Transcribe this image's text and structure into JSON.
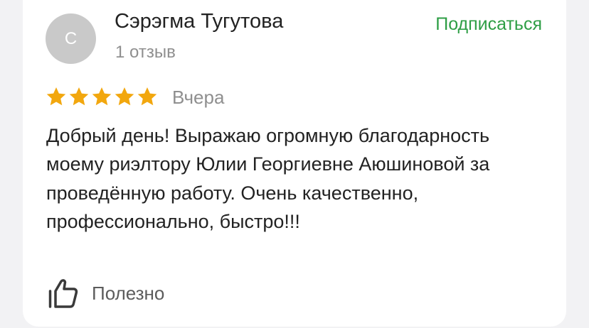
{
  "review": {
    "author": {
      "initial": "С",
      "name": "Сэрэгма Тугутова",
      "reviews_count": "1 отзыв"
    },
    "subscribe_label": "Подписаться",
    "rating": 5,
    "rating_max": 5,
    "date": "Вчера",
    "text": "Добрый день! Выражаю огромную благодарность моему риэлтору Юлии Георгиевне Аюшиновой за проведённую работу. Очень качественно, профессионально, быстро!!!",
    "helpful_label": "Полезно"
  },
  "icons": {
    "star": "star-icon",
    "helpful": "thumbs-up-icon"
  },
  "colors": {
    "accent_green": "#2e9e45",
    "star": "#f2a70e",
    "avatar_bg": "#c9c9c9"
  }
}
